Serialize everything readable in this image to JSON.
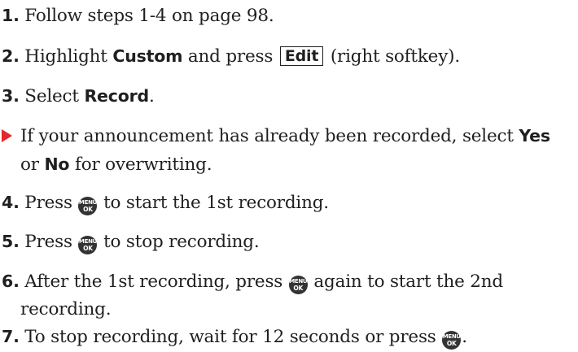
{
  "steps": {
    "s1": {
      "num": "1.",
      "text": "Follow steps 1-4 on page 98."
    },
    "s2": {
      "num": "2.",
      "pre": "Highlight ",
      "bold": "Custom",
      "mid": " and press ",
      "softkey": "Edit",
      "post": " (right softkey)."
    },
    "s3": {
      "num": "3.",
      "pre": "Select ",
      "bold": "Record",
      "post": "."
    },
    "note": {
      "pre": "If your announcement has already been recorded, select ",
      "bold1": "Yes",
      "mid": "or ",
      "bold2": "No",
      "post": " for overwriting."
    },
    "s4": {
      "num": "4.",
      "pre": "Press ",
      "post": " to start the 1st recording."
    },
    "s5": {
      "num": "5.",
      "pre": "Press ",
      "post": " to stop recording."
    },
    "s6": {
      "num": "6.",
      "pre": "After the 1st recording, press ",
      "post": " again to start the 2nd",
      "line2": "recording."
    },
    "s7": {
      "num": "7.",
      "pre": "To stop recording, wait for 12 seconds or press ",
      "post": "."
    }
  },
  "icons": {
    "menu_ok_line1": "MENU",
    "menu_ok_line2": "OK",
    "bullet_color": "#e4282c",
    "menu_ok_color": "#333333"
  }
}
